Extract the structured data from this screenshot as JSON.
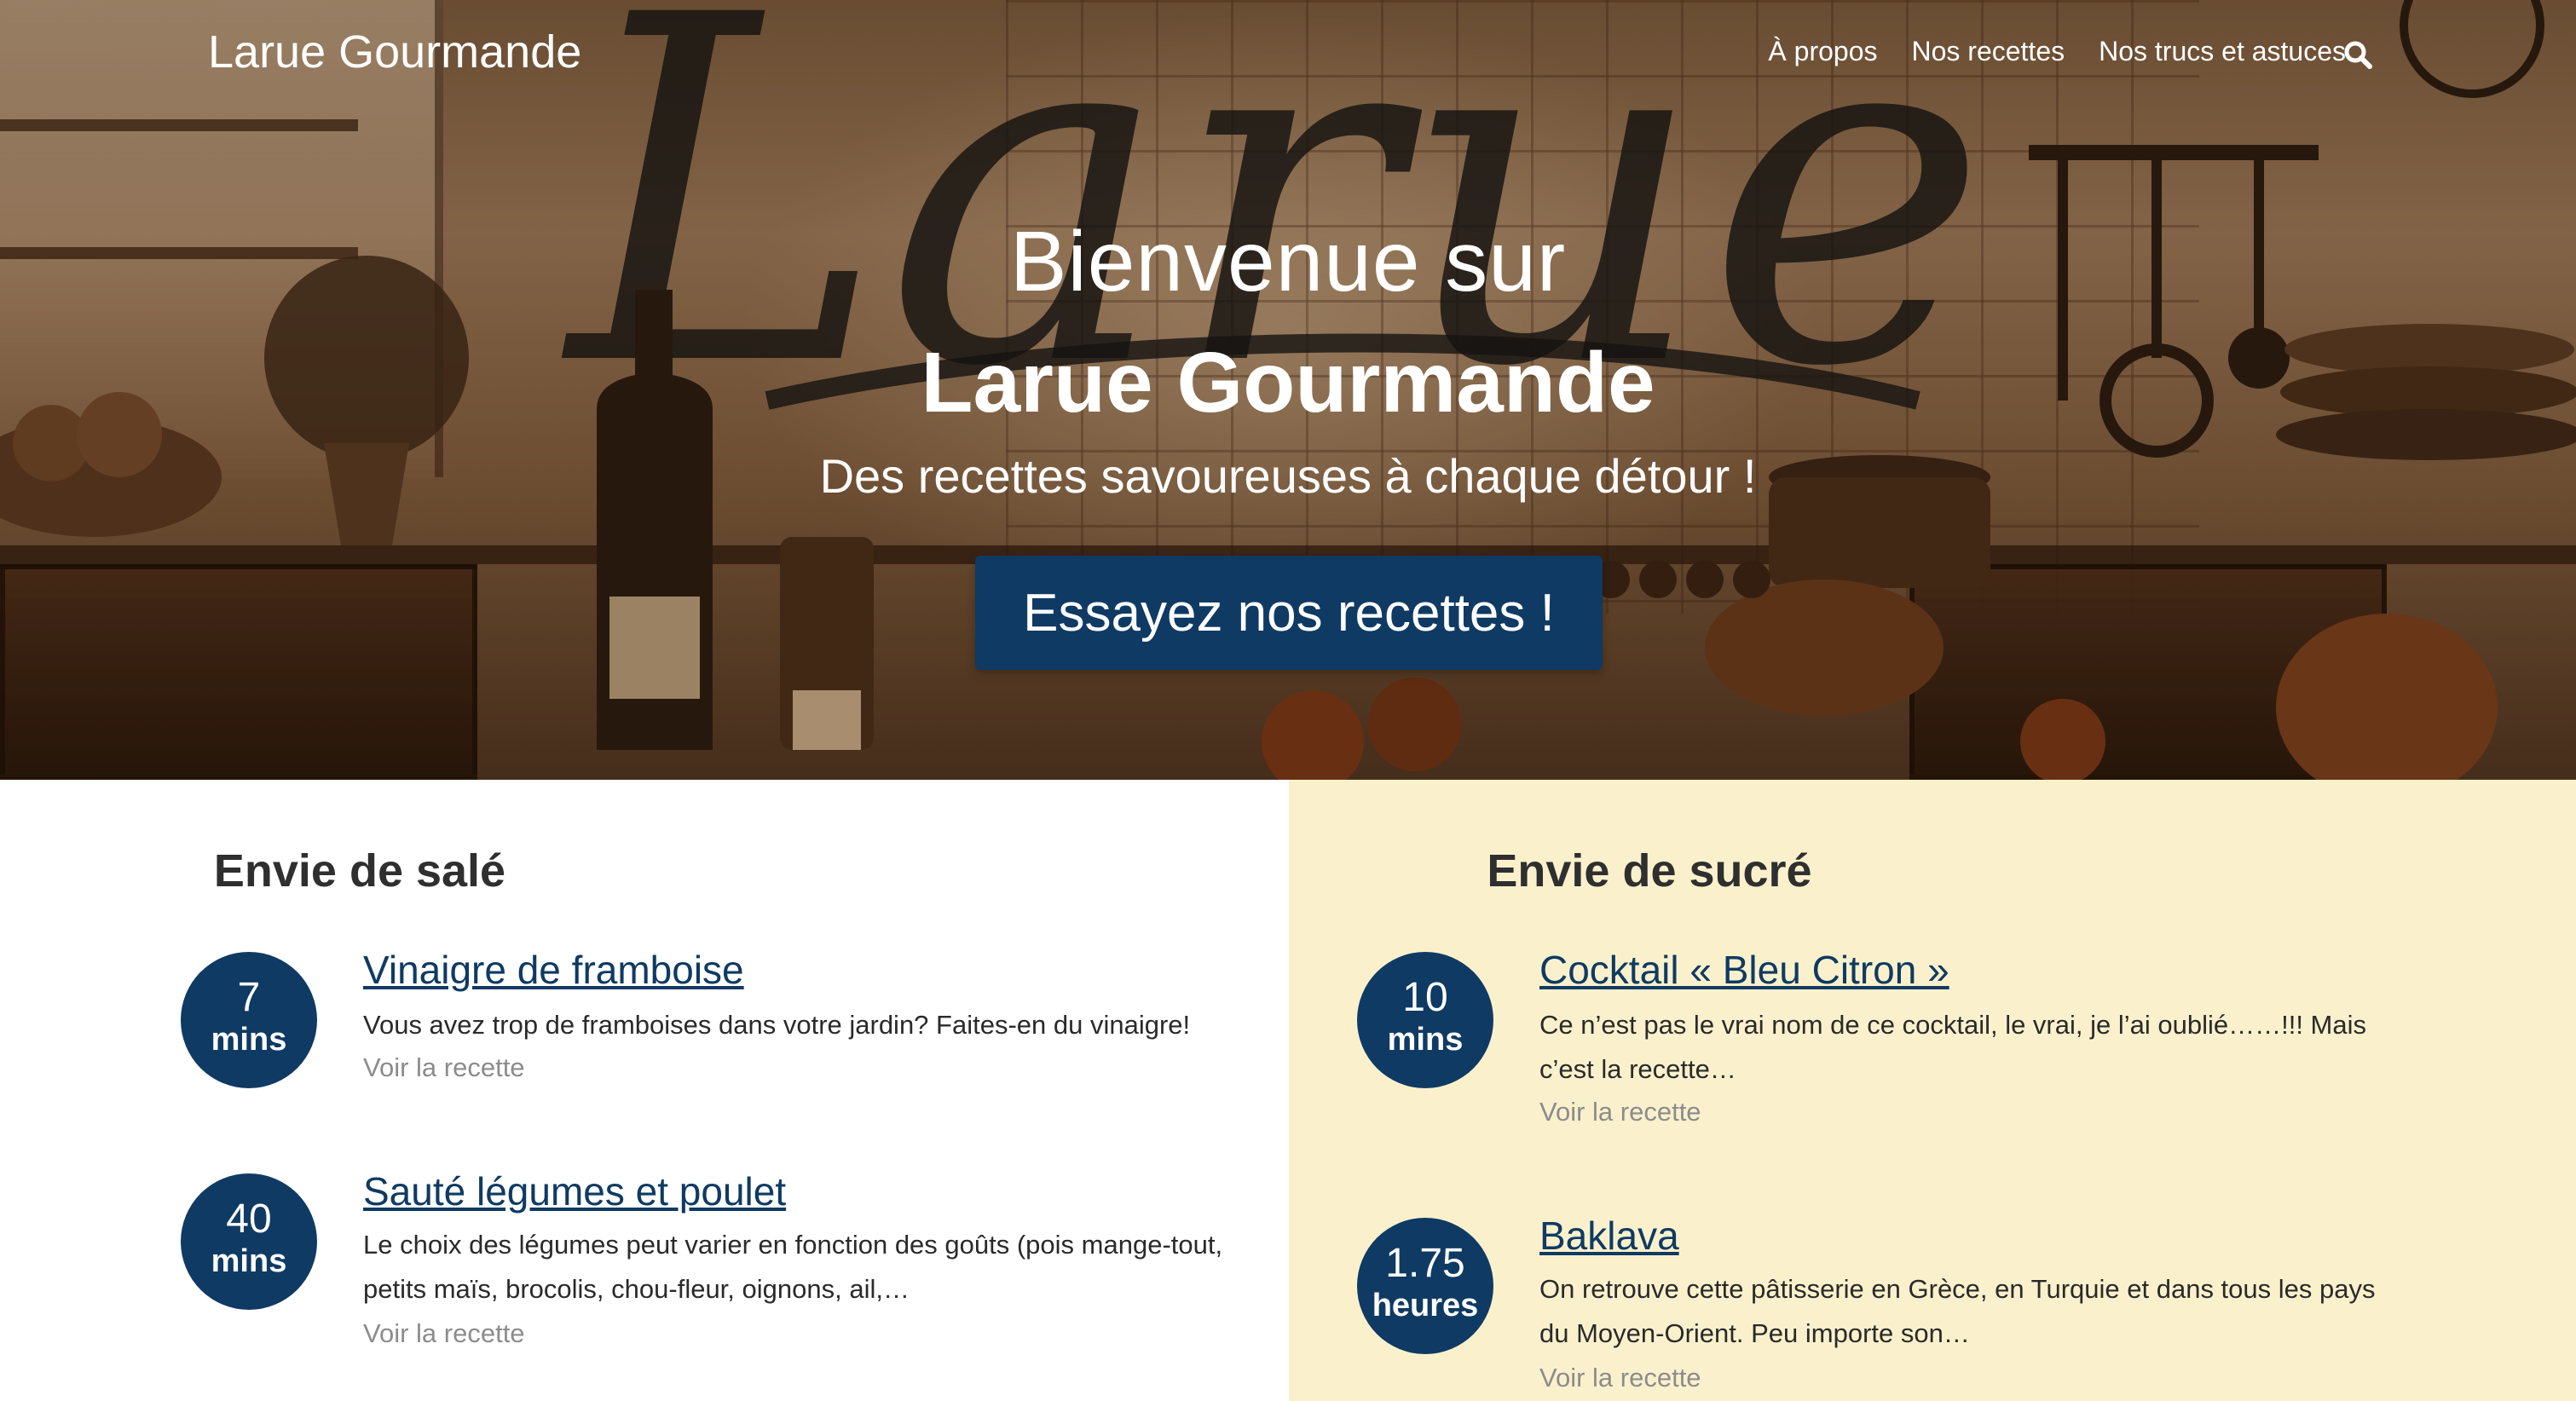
{
  "header": {
    "site_title": "Larue Gourmande",
    "nav": [
      "À propos",
      "Nos recettes",
      "Nos trucs et astuces"
    ]
  },
  "hero": {
    "line1": "Bienvenue sur",
    "line2": "Larue Gourmande",
    "subtitle": "Des recettes savoureuses à chaque détour !",
    "cta": "Essayez nos recettes !",
    "background_script_text": "Larue"
  },
  "sections": {
    "savory": {
      "title": "Envie de salé",
      "recipes": [
        {
          "time": "7",
          "unit": "mins",
          "title": "Vinaigre de framboise",
          "description": "Vous avez trop de framboises dans votre jardin? Faites-en du vinaigre!",
          "more": "Voir la recette"
        },
        {
          "time": "40",
          "unit": "mins",
          "title": "Sauté légumes et poulet",
          "description": "Le choix des légumes peut varier en fonction des goûts (pois mange-tout, petits maïs, brocolis, chou-fleur, oignons, ail,…",
          "more": "Voir la recette"
        }
      ]
    },
    "sweet": {
      "title": "Envie de sucré",
      "recipes": [
        {
          "time": "10",
          "unit": "mins",
          "title": "Cocktail « Bleu Citron »",
          "description": " Ce n’est pas le vrai nom de ce cocktail, le vrai, je l’ai oublié……!!! Mais c’est la recette…",
          "more": "Voir la recette"
        },
        {
          "time": "1.75",
          "unit": "heures",
          "title": "Baklava",
          "description": "On retrouve cette pâtisserie en Grèce, en Turquie et dans tous les pays du Moyen-Orient. Peu importe son…",
          "more": "Voir la recette"
        }
      ]
    }
  },
  "colors": {
    "accent": "#0f3a63",
    "sweet_background": "#faf1cc",
    "muted_link": "#8c8c8c"
  },
  "icons": {
    "search": "search-icon"
  }
}
